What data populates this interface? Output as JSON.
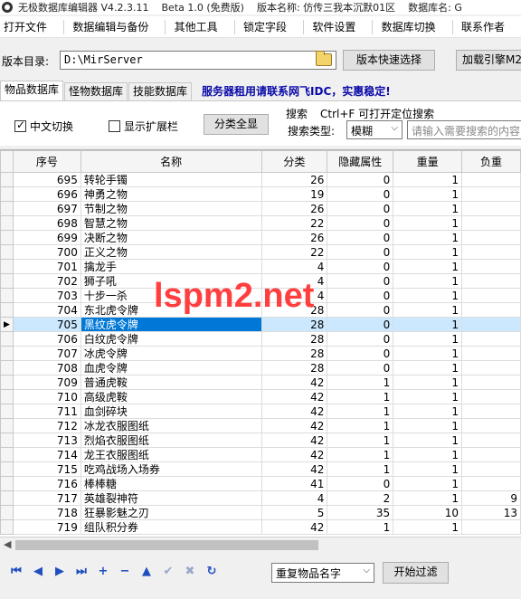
{
  "titlebar": {
    "parts": [
      "无极数据库编辑器 V4.2.3.11",
      "Beta 1.0 (免费版)",
      "版本名称: 仿传三我本沉默01区",
      "数据库名: G"
    ]
  },
  "menu": [
    "打开文件",
    "数据编辑与备份",
    "其他工具",
    "锁定字段",
    "软件设置",
    "数据库切换",
    "联系作者"
  ],
  "dir": {
    "label": "版本目录:",
    "value": "D:\\MirServer",
    "quick_button": "版本快速选择",
    "load_button": "加载引擎M2"
  },
  "tabs": [
    "物品数据库",
    "怪物数据库",
    "技能数据库"
  ],
  "promo": "服务器租用请联系网飞IDC，实惠稳定!",
  "options": {
    "chinese_switch": "中文切换",
    "chinese_switch_checked": true,
    "show_ext": "显示扩展栏",
    "show_ext_checked": false,
    "show_all_button": "分类全显"
  },
  "search": {
    "title": "搜索",
    "shortcut_hint": "Ctrl+F 可打开定位搜索",
    "type_label": "搜索类型:",
    "type_value": "模糊",
    "placeholder": "请输入需要搜索的内容"
  },
  "table": {
    "columns": [
      "序号",
      "名称",
      "分类",
      "隐藏属性",
      "重量",
      "负重"
    ],
    "selected_index": 10,
    "rows": [
      {
        "id": "695",
        "name": "转轮手镯",
        "cat": "26",
        "hidden": "0",
        "weight": "1",
        "load": ""
      },
      {
        "id": "696",
        "name": "神勇之物",
        "cat": "19",
        "hidden": "0",
        "weight": "1",
        "load": ""
      },
      {
        "id": "697",
        "name": "节制之物",
        "cat": "26",
        "hidden": "0",
        "weight": "1",
        "load": ""
      },
      {
        "id": "698",
        "name": "智慧之物",
        "cat": "22",
        "hidden": "0",
        "weight": "1",
        "load": ""
      },
      {
        "id": "699",
        "name": "决断之物",
        "cat": "26",
        "hidden": "0",
        "weight": "1",
        "load": ""
      },
      {
        "id": "700",
        "name": "正义之物",
        "cat": "22",
        "hidden": "0",
        "weight": "1",
        "load": ""
      },
      {
        "id": "701",
        "name": "擒龙手",
        "cat": "4",
        "hidden": "0",
        "weight": "1",
        "load": ""
      },
      {
        "id": "702",
        "name": "狮子吼",
        "cat": "4",
        "hidden": "0",
        "weight": "1",
        "load": ""
      },
      {
        "id": "703",
        "name": "十步一杀",
        "cat": "4",
        "hidden": "0",
        "weight": "1",
        "load": ""
      },
      {
        "id": "704",
        "name": "东北虎令牌",
        "cat": "28",
        "hidden": "0",
        "weight": "1",
        "load": ""
      },
      {
        "id": "705",
        "name": "黑纹虎令牌",
        "cat": "28",
        "hidden": "0",
        "weight": "1",
        "load": ""
      },
      {
        "id": "706",
        "name": "白纹虎令牌",
        "cat": "28",
        "hidden": "0",
        "weight": "1",
        "load": ""
      },
      {
        "id": "707",
        "name": "冰虎令牌",
        "cat": "28",
        "hidden": "0",
        "weight": "1",
        "load": ""
      },
      {
        "id": "708",
        "name": "血虎令牌",
        "cat": "28",
        "hidden": "0",
        "weight": "1",
        "load": ""
      },
      {
        "id": "709",
        "name": "普通虎鞍",
        "cat": "42",
        "hidden": "1",
        "weight": "1",
        "load": ""
      },
      {
        "id": "710",
        "name": "高级虎鞍",
        "cat": "42",
        "hidden": "1",
        "weight": "1",
        "load": ""
      },
      {
        "id": "711",
        "name": "血剑碎块",
        "cat": "42",
        "hidden": "1",
        "weight": "1",
        "load": ""
      },
      {
        "id": "712",
        "name": "冰龙衣服图纸",
        "cat": "42",
        "hidden": "1",
        "weight": "1",
        "load": ""
      },
      {
        "id": "713",
        "name": "烈焰衣服图纸",
        "cat": "42",
        "hidden": "1",
        "weight": "1",
        "load": ""
      },
      {
        "id": "714",
        "name": "龙王衣服图纸",
        "cat": "42",
        "hidden": "1",
        "weight": "1",
        "load": ""
      },
      {
        "id": "715",
        "name": "吃鸡战场入场券",
        "cat": "42",
        "hidden": "1",
        "weight": "1",
        "load": ""
      },
      {
        "id": "716",
        "name": "棒棒糖",
        "cat": "41",
        "hidden": "0",
        "weight": "1",
        "load": ""
      },
      {
        "id": "717",
        "name": "英雄裂神符",
        "cat": "4",
        "hidden": "2",
        "weight": "1",
        "load": "9"
      },
      {
        "id": "718",
        "name": "狂暴影魅之刃",
        "cat": "5",
        "hidden": "35",
        "weight": "10",
        "load": "13"
      },
      {
        "id": "719",
        "name": "组队积分券",
        "cat": "42",
        "hidden": "1",
        "weight": "1",
        "load": ""
      }
    ]
  },
  "nav": {
    "icons": [
      "first-icon",
      "prev-page-icon",
      "prev-icon",
      "next-icon",
      "last-icon",
      "add-icon",
      "remove-icon",
      "edit-icon",
      "confirm-icon",
      "cancel-icon",
      "refresh-icon"
    ],
    "filter_value": "重复物品名字",
    "filter_button": "开始过滤"
  },
  "watermark": "lspm2.net"
}
